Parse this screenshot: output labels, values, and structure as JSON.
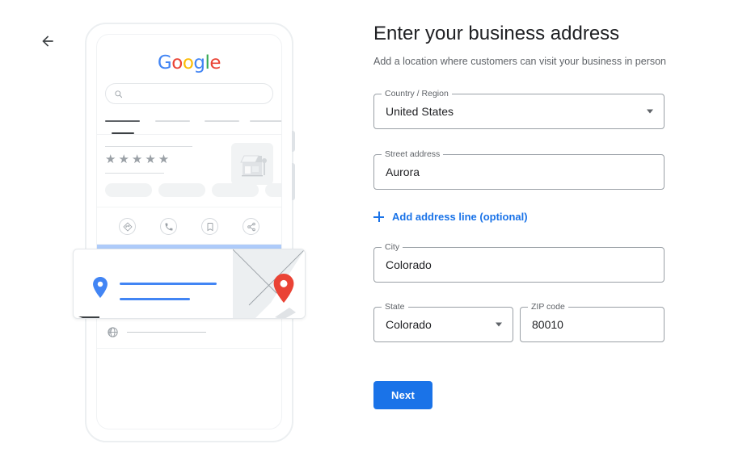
{
  "nav": {
    "back_icon": "arrow-left-icon"
  },
  "header": {
    "title": "Enter your business address",
    "subtitle": "Add a location where customers can visit your business in person"
  },
  "form": {
    "fields": [
      {
        "label": "Country / Region",
        "value": "United States",
        "type": "select",
        "name": "country-region"
      },
      {
        "label": "Street address",
        "value": "Aurora",
        "type": "text",
        "name": "street-address"
      },
      {
        "label": "City",
        "value": "Colorado",
        "type": "text",
        "name": "city"
      },
      {
        "label": "State",
        "value": "Colorado",
        "type": "select",
        "name": "state"
      },
      {
        "label": "ZIP code",
        "value": "80010",
        "type": "text",
        "name": "zip-code"
      }
    ],
    "add_address_line": {
      "label": "Add address line (optional)",
      "icon": "plus-icon"
    },
    "submit": {
      "label": "Next"
    }
  },
  "illustration": {
    "phone": {
      "brand": {
        "letters": [
          "G",
          "o",
          "o",
          "g",
          "l",
          "e"
        ]
      },
      "search": {
        "icon": "search-icon",
        "placeholder": ""
      },
      "stars": "★★★★★",
      "business_photo_icon": "storefront-icon",
      "action_icons": [
        "directions-icon",
        "call-icon",
        "bookmark-icon",
        "share-icon"
      ],
      "info_icons": [
        "clock-icon",
        "phone-icon",
        "globe-icon"
      ]
    },
    "address_card": {
      "pin_icon": "map-pin-icon",
      "map_pin_icon": "map-pin-red-icon"
    }
  },
  "colors": {
    "accent": "#1a73e8",
    "text_primary": "#202124",
    "text_secondary": "#5f6368",
    "border": "#9aa0a6",
    "pin_red": "#EA4335",
    "pin_blue": "#4285F4",
    "blue_bar": "#aecbfa"
  }
}
